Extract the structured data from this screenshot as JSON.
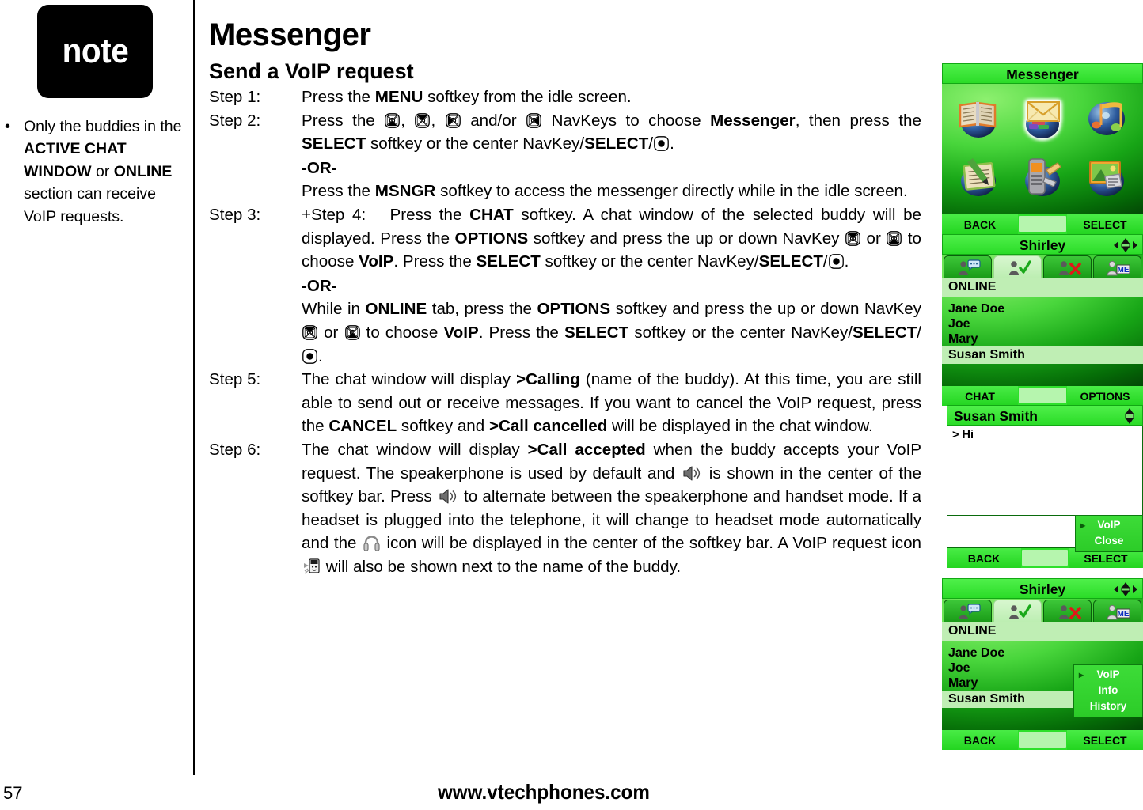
{
  "note": {
    "badge_label": "note",
    "bullet_glyph": "•",
    "text_parts": [
      {
        "t": "Only the buddies in the ",
        "b": false
      },
      {
        "t": "ACTIVE CHAT WINDOW",
        "b": true
      },
      {
        "t": " or ",
        "b": false
      },
      {
        "t": "ONLINE",
        "b": true
      },
      {
        "t": " section can receive VoIP requests.",
        "b": false
      }
    ]
  },
  "page": {
    "title": "Messenger",
    "subtitle": "Send a VoIP request",
    "number": "57",
    "url": "www.vtechphones.com"
  },
  "steps": [
    {
      "label": "Step 1:",
      "lines": [
        [
          {
            "t": "Press the ",
            "b": false
          },
          {
            "t": "MENU",
            "b": true
          },
          {
            "t": " softkey from the idle screen.",
            "b": false
          }
        ]
      ]
    },
    {
      "label": "Step 2:",
      "lines": [
        [
          {
            "t": "Press the ",
            "b": false
          },
          {
            "icon": "navkey-down"
          },
          {
            "t": ", ",
            "b": false
          },
          {
            "icon": "navkey-up"
          },
          {
            "t": ", ",
            "b": false
          },
          {
            "icon": "navkey-left"
          },
          {
            "t": " and/or ",
            "b": false
          },
          {
            "icon": "navkey-right"
          },
          {
            "t": " NavKeys to choose ",
            "b": false
          },
          {
            "t": "Messenger",
            "b": true
          },
          {
            "t": ", then press the ",
            "b": false
          },
          {
            "t": "SELECT",
            "b": true
          },
          {
            "t": " softkey or the center NavKey/",
            "b": false
          },
          {
            "t": "SELECT",
            "b": true
          },
          {
            "t": "/",
            "b": false
          },
          {
            "icon": "navkey-center"
          },
          {
            "t": ".",
            "b": false
          }
        ],
        [
          {
            "t": "-OR-",
            "b": true,
            "style": "or"
          }
        ],
        [
          {
            "t": "Press the ",
            "b": false
          },
          {
            "t": "MSNGR",
            "b": true
          },
          {
            "t": " softkey to access the messenger directly while in the idle screen.",
            "b": false
          }
        ]
      ]
    },
    {
      "label": "Step 3:",
      "lines": [
        [
          {
            "t": "+Step 4:",
            "b": false
          },
          {
            "t": "  Press the ",
            "b": false
          },
          {
            "t": "CHAT",
            "b": true
          },
          {
            "t": " softkey. A chat window of the selected buddy will be displayed. Press the ",
            "b": false
          },
          {
            "t": "OPTIONS",
            "b": true
          },
          {
            "t": " softkey and press the up or down NavKey ",
            "b": false
          },
          {
            "icon": "navkey-up"
          },
          {
            "t": " or ",
            "b": false
          },
          {
            "icon": "navkey-down"
          },
          {
            "t": " to choose ",
            "b": false
          },
          {
            "t": "VoIP",
            "b": true
          },
          {
            "t": ". Press the ",
            "b": false
          },
          {
            "t": "SELECT",
            "b": true
          },
          {
            "t": " softkey or the center NavKey/",
            "b": false
          },
          {
            "t": "SELECT",
            "b": true
          },
          {
            "t": "/",
            "b": false
          },
          {
            "icon": "navkey-center"
          },
          {
            "t": ".",
            "b": false
          }
        ],
        [
          {
            "t": "-OR-",
            "b": true,
            "style": "or"
          }
        ],
        [
          {
            "t": "While in ",
            "b": false
          },
          {
            "t": "ONLINE",
            "b": true
          },
          {
            "t": " tab, press the ",
            "b": false
          },
          {
            "t": "OPTIONS",
            "b": true
          },
          {
            "t": " softkey and press the up or down NavKey ",
            "b": false
          },
          {
            "icon": "navkey-up"
          },
          {
            "t": " or ",
            "b": false
          },
          {
            "icon": "navkey-down"
          },
          {
            "t": " to choose ",
            "b": false
          },
          {
            "t": "VoIP",
            "b": true
          },
          {
            "t": ". Press the ",
            "b": false
          },
          {
            "t": "SELECT",
            "b": true
          },
          {
            "t": " softkey or the center NavKey/",
            "b": false
          },
          {
            "t": "SELECT",
            "b": true
          },
          {
            "t": "/",
            "b": false
          },
          {
            "icon": "navkey-center"
          },
          {
            "t": ".",
            "b": false
          }
        ]
      ]
    },
    {
      "label": "Step 5:",
      "lines": [
        [
          {
            "t": "The chat window will display ",
            "b": false
          },
          {
            "t": ">Calling",
            "b": true
          },
          {
            "t": " (name of the buddy). At this time, you are still able to send out or receive messages. If you want to cancel the VoIP request, press the ",
            "b": false
          },
          {
            "t": "CANCEL",
            "b": true
          },
          {
            "t": " softkey and ",
            "b": false
          },
          {
            "t": ">Call cancelled",
            "b": true
          },
          {
            "t": " will be displayed in the chat window.",
            "b": false
          }
        ]
      ]
    },
    {
      "label": "Step 6:",
      "lines": [
        [
          {
            "t": "The chat window will display ",
            "b": false
          },
          {
            "t": ">Call accepted",
            "b": true
          },
          {
            "t": " when the buddy accepts  your VoIP request. The speakerphone is used by default and ",
            "b": false
          },
          {
            "icon": "speaker"
          },
          {
            "t": " is shown in the center of the softkey bar. Press ",
            "b": false
          },
          {
            "icon": "speaker"
          },
          {
            "t": " to alternate between the speakerphone and handset mode. If a headset is plugged into the telephone, it will change to headset mode automatically and the ",
            "b": false
          },
          {
            "icon": "headset"
          },
          {
            "t": " icon will be displayed in the center of the softkey bar. A VoIP request icon ",
            "b": false
          },
          {
            "icon": "voip-request"
          },
          {
            "t": " will also be shown next to the name of the buddy.",
            "b": false
          }
        ]
      ]
    }
  ],
  "screens": {
    "messenger": {
      "title": "Messenger",
      "grid_icons": [
        {
          "name": "phonebook-icon",
          "selected": false
        },
        {
          "name": "message-envelope-icon",
          "selected": true
        },
        {
          "name": "music-notes-icon",
          "selected": false
        },
        {
          "name": "notepad-pen-icon",
          "selected": false
        },
        {
          "name": "handset-tools-icon",
          "selected": false
        },
        {
          "name": "picture-gallery-icon",
          "selected": false
        }
      ],
      "softkey_left": "BACK",
      "softkey_right": "SELECT"
    },
    "buddylist1": {
      "title": "Shirley",
      "nav_indicator": "four-way-nav-icon",
      "tabs": [
        {
          "name": "tab-chat",
          "icon": "person-chat-icon",
          "active": false
        },
        {
          "name": "tab-online",
          "icon": "person-check-icon",
          "active": true
        },
        {
          "name": "tab-offline",
          "icon": "person-x-icon",
          "active": false
        },
        {
          "name": "tab-me",
          "icon": "person-me-icon",
          "active": false
        }
      ],
      "section_header": "ONLINE",
      "buddies": [
        {
          "name": "Jane Doe",
          "selected": false
        },
        {
          "name": "Joe",
          "selected": false
        },
        {
          "name": "Mary",
          "selected": false
        },
        {
          "name": "Susan Smith",
          "selected": true
        }
      ],
      "softkey_left": "CHAT",
      "softkey_right": "OPTIONS"
    },
    "chat": {
      "title": "Susan Smith",
      "scroll_indicator": "up-down-scroll-icon",
      "message": "> Hi",
      "menu": [
        "VoIP",
        "Close"
      ],
      "softkey_left": "BACK",
      "softkey_right": "SELECT"
    },
    "buddylist2": {
      "title": "Shirley",
      "nav_indicator": "four-way-nav-icon",
      "tabs": [
        {
          "name": "tab-chat",
          "icon": "person-chat-icon",
          "active": false
        },
        {
          "name": "tab-online",
          "icon": "person-check-icon",
          "active": true
        },
        {
          "name": "tab-offline",
          "icon": "person-x-icon",
          "active": false
        },
        {
          "name": "tab-me",
          "icon": "person-me-icon",
          "active": false
        }
      ],
      "section_header": "ONLINE",
      "buddies": [
        {
          "name": "Jane Doe",
          "selected": false
        },
        {
          "name": "Joe",
          "selected": false
        },
        {
          "name": "Mary",
          "selected": false
        },
        {
          "name": "Susan Smith",
          "selected": true
        }
      ],
      "menu": [
        "VoIP",
        "Info",
        "History"
      ],
      "softkey_left": "BACK",
      "softkey_right": "SELECT"
    }
  },
  "colors": {
    "screen_accent_green": "#2ee02b",
    "screen_dark_green": "#056b07",
    "highlight_pale_green": "#bfeeb4",
    "note_badge_bg": "#000000"
  }
}
